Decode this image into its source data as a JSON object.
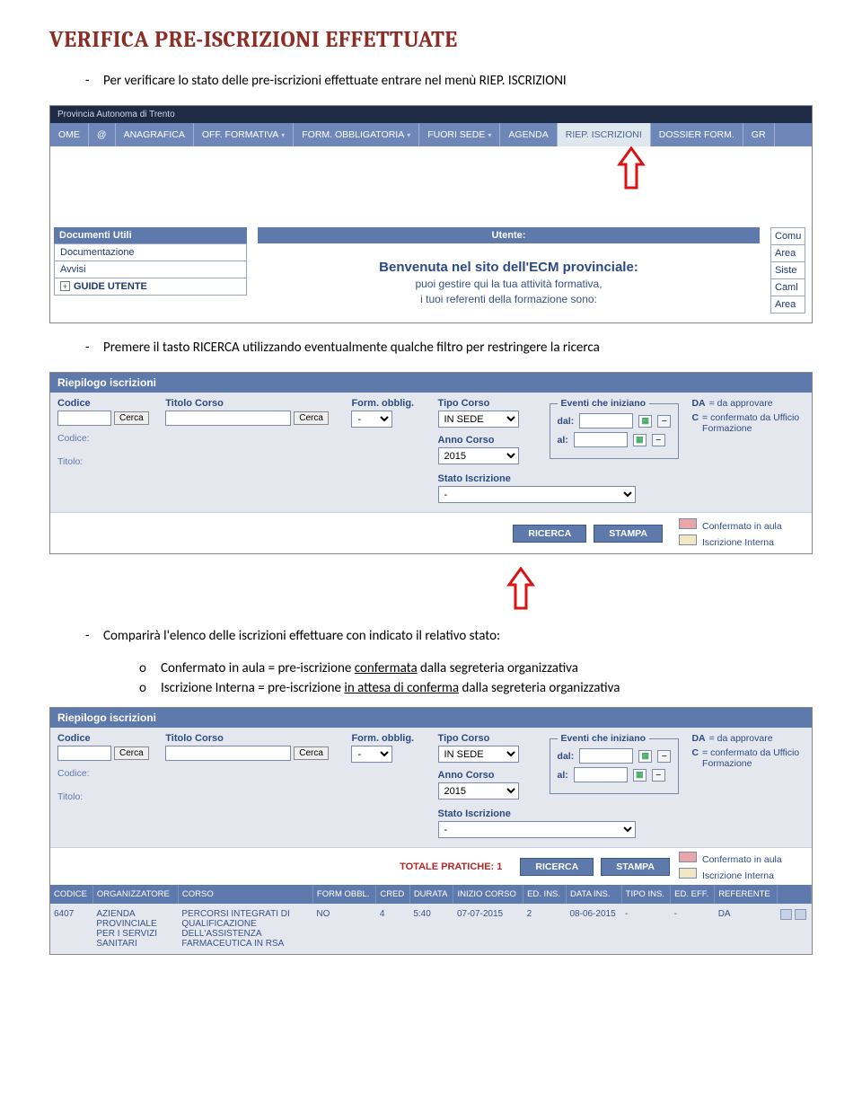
{
  "title": "VERIFICA PRE-ISCRIZIONI EFFETTUATE",
  "para1": "Per verificare lo stato delle pre-iscrizioni effettuate entrare nel menù RIEP. ISCRIZIONI",
  "para2": "Premere il tasto RICERCA utilizzando eventualmente qualche filtro per restringere la ricerca",
  "para3": "Comparirà l'elenco delle iscrizioni effettuare con indicato il relativo stato:",
  "sub1_a": "Confermato in aula = pre-iscrizione ",
  "sub1_u": "confermata",
  "sub1_b": " dalla segreteria organizzativa",
  "sub2_a": "Iscrizione Interna = pre-iscrizione ",
  "sub2_u": "in attesa di conferma",
  "sub2_b": " dalla segreteria organizzativa",
  "top_line2": "Provincia Autonoma di Trento",
  "nav": {
    "home": "OME",
    "at": "@",
    "anagrafica": "ANAGRAFICA",
    "off_form": "OFF. FORMATIVA",
    "form_obb": "FORM. OBBLIGATORIA",
    "fuori": "FUORI SEDE",
    "agenda": "AGENDA",
    "riep": "RIEP. ISCRIZIONI",
    "dossier": "DOSSIER FORM.",
    "gr": "GR"
  },
  "docutili_header": "Documenti Utili",
  "docutili": {
    "r1": "Documentazione",
    "r2": "Avvisi",
    "r3": "GUIDE UTENTE"
  },
  "utente_header": "Utente:",
  "welcome": "Benvenuta nel sito dell'ECM provinciale:",
  "welcome_l1": "puoi gestire qui la tua attività formativa,",
  "welcome_l2": "i tuoi referenti della formazione sono:",
  "right_rows": {
    "r1": "Comu",
    "r2": "Area",
    "r3": "Siste",
    "r4": "Caml",
    "r5": "Area"
  },
  "filt": {
    "header": "Riepilogo iscrizioni",
    "codice": "Codice",
    "titolo": "Titolo Corso",
    "form_obblig": "Form. obblig.",
    "tipo_corso": "Tipo Corso",
    "anno_corso": "Anno Corso",
    "cerca": "Cerca",
    "form_obblig_val": "-",
    "tipo_corso_val": "IN SEDE",
    "anno_val": "2015",
    "eventi": "Eventi che iniziano",
    "dal": "dal:",
    "al": "al:",
    "stato": "Stato Iscrizione",
    "stato_val": "-",
    "da": "DA",
    "da_txt": "= da approvare",
    "c": "C",
    "c_txt": "confermato da Ufficio Formazione",
    "meta_codice": "Codice:",
    "meta_titolo": "Titolo:",
    "sw1": "Confermato in aula",
    "sw2": "Iscrizione Interna",
    "ricerca": "RICERCA",
    "stampa": "STAMPA",
    "totale": "TOTALE PRATICHE: 1"
  },
  "res": {
    "h": {
      "codice": "CODICE",
      "org": "ORGANIZZATORE",
      "corso": "CORSO",
      "form": "FORM OBBL.",
      "cred": "CRED",
      "durata": "DURATA",
      "inizio": "INIZIO CORSO",
      "edins": "ED. INS.",
      "datains": "DATA INS.",
      "tipoins": "TIPO INS.",
      "edeff": "ED. EFF.",
      "ref": "REFERENTE"
    },
    "row": {
      "codice": "6407",
      "org": "AZIENDA PROVINCIALE PER I SERVIZI SANITARI",
      "corso": "PERCORSI INTEGRATI DI QUALIFICAZIONE DELL'ASSISTENZA FARMACEUTICA IN RSA",
      "form": "NO",
      "cred": "4",
      "durata": "5:40",
      "inizio": "07-07-2015",
      "edins": "2",
      "datains": "08-06-2015",
      "tipoins": "-",
      "edeff": "-",
      "ref": "DA"
    }
  }
}
